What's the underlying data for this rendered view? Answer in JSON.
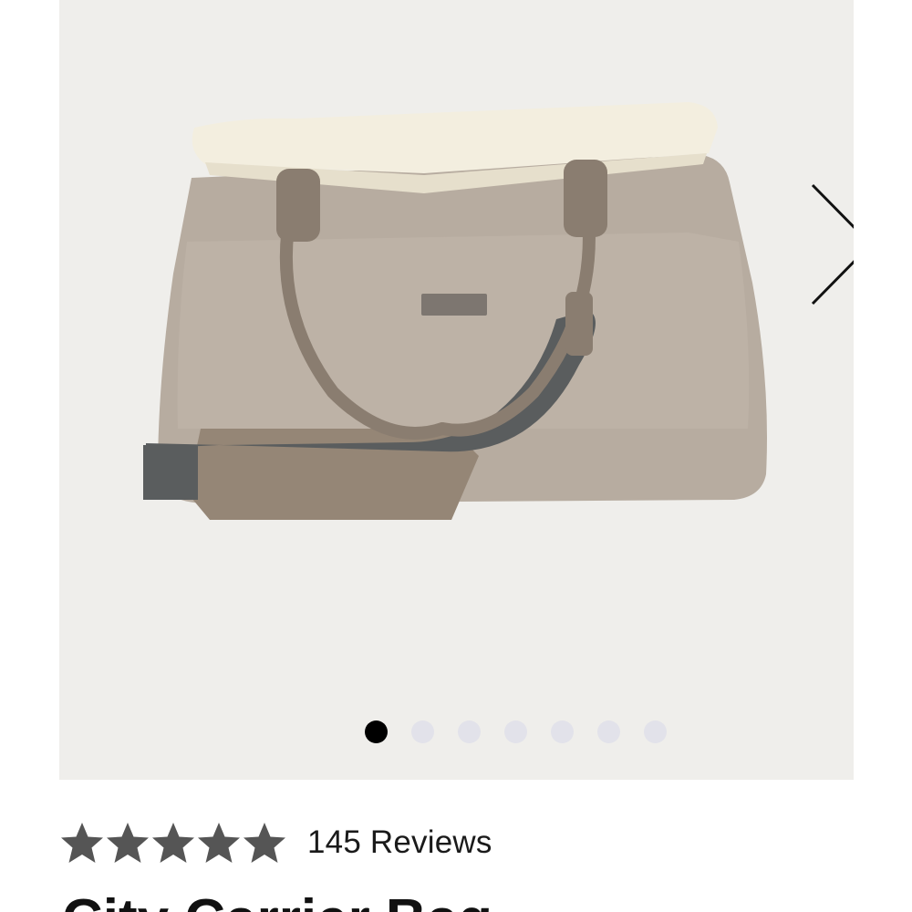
{
  "gallery": {
    "image_alt": "",
    "slide_count": 7,
    "active_slide": 1,
    "next_icon": "chevron-right-icon",
    "colors": {
      "background": "#efeeeb",
      "dot_active": "#000000",
      "dot_inactive": "#e2e2ea"
    }
  },
  "rating": {
    "stars": 5,
    "star_icon": "star-icon",
    "star_color": "#555555",
    "reviews_label": "145 Reviews"
  },
  "product": {
    "title": "City Carrier Bag"
  }
}
